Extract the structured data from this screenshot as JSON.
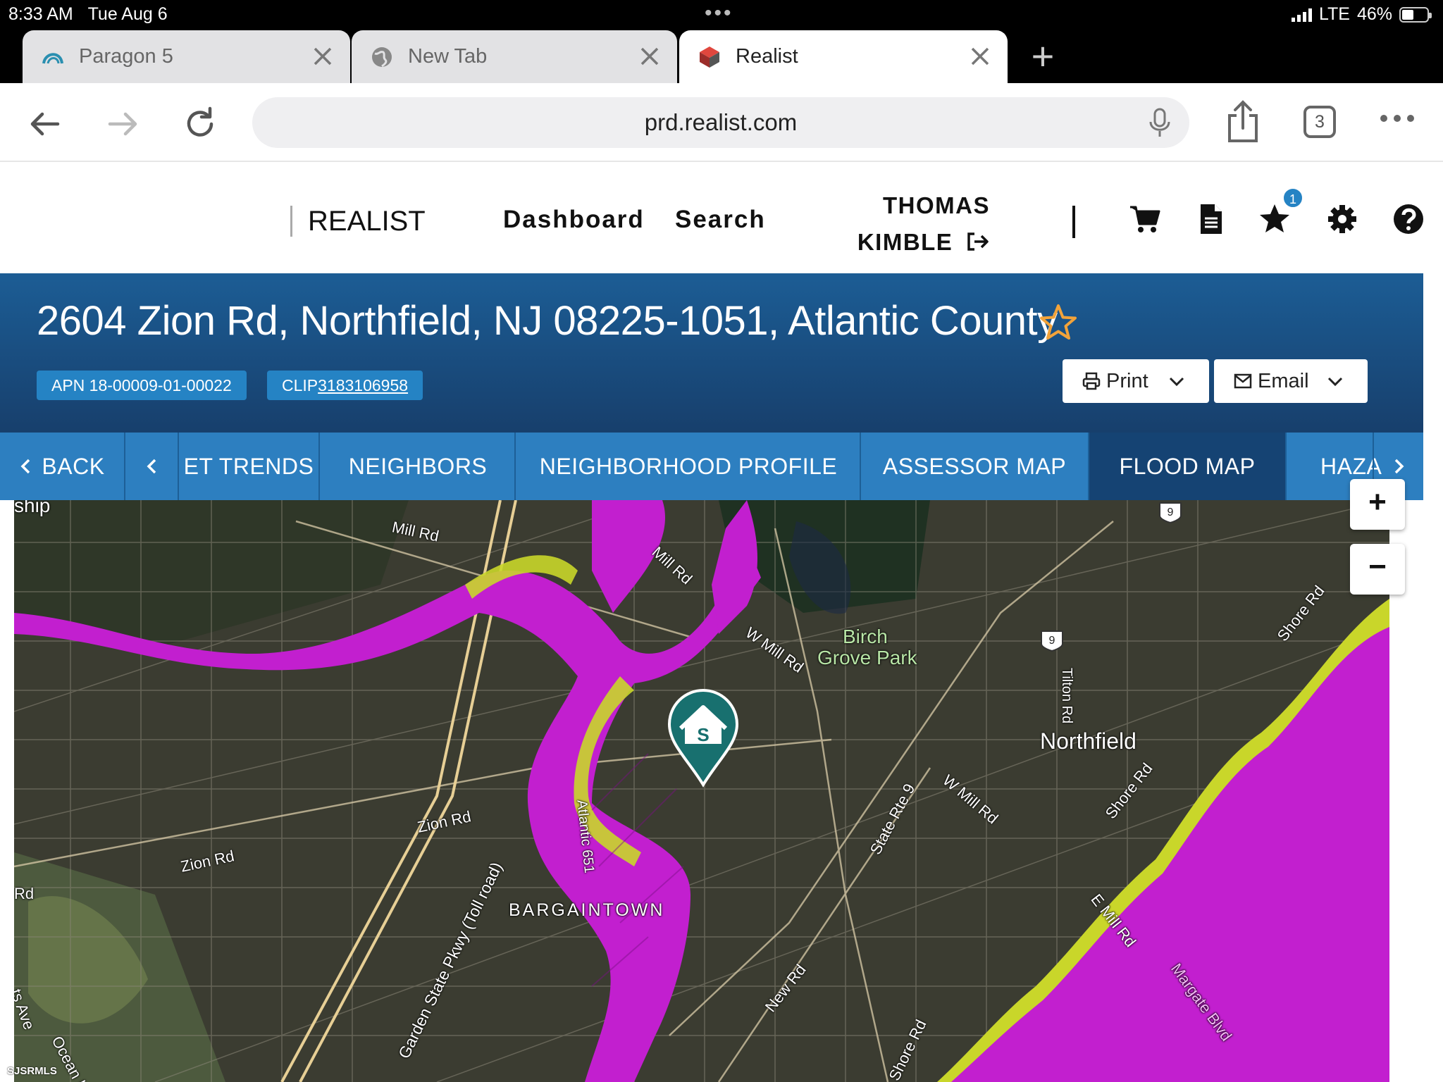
{
  "status_bar": {
    "time": "8:33 AM",
    "date": "Tue Aug 6",
    "network": "LTE",
    "battery": "46%"
  },
  "browser": {
    "tabs": [
      {
        "title": "Paragon 5",
        "icon": "paragon-icon"
      },
      {
        "title": "New Tab",
        "icon": "globe-icon"
      },
      {
        "title": "Realist",
        "icon": "realist-icon",
        "active": true
      }
    ],
    "url": "prd.realist.com",
    "tab_count": "3"
  },
  "site": {
    "logo": "REALIST",
    "nav": {
      "dashboard": "Dashboard",
      "search": "Search"
    },
    "user": {
      "first": "THOMAS",
      "last": "KIMBLE"
    },
    "favorites_count": "1"
  },
  "property": {
    "address": "2604 Zion Rd, Northfield, NJ 08225-1051, Atlantic County",
    "apn": "APN 18-00009-01-00022",
    "clip_prefix": "CLIP",
    "clip_number": "3183106958",
    "print_label": "Print",
    "email_label": "Email"
  },
  "page_tabs": {
    "back": "BACK",
    "items": [
      "ET TRENDS",
      "NEIGHBORS",
      "NEIGHBORHOOD PROFILE",
      "ASSESSOR MAP",
      "FLOOD MAP",
      "HAZA"
    ],
    "active": "FLOOD MAP"
  },
  "map": {
    "labels": {
      "ship": "ship",
      "mill_rd_1": "Mill Rd",
      "mill_rd_2": "Mill Rd",
      "w_mill_rd_1": "W Mill Rd",
      "w_mill_rd_2": "W Mill Rd",
      "birch": "Birch",
      "grove_park": "Grove Park",
      "northfield": "Northfield",
      "tilton_rd": "Tilton Rd",
      "shore_rd_1": "Shore Rd",
      "shore_rd_2": "Shore Rd",
      "shore_rd_3": "Shore Rd",
      "zion_rd_1": "Zion Rd",
      "zion_rd_2": "Zion Rd",
      "rd": "Rd",
      "atlantic_651": "Atlantic 651",
      "state_rte_9": "State Rte 9",
      "bargaintown": "BARGAINTOWN",
      "gsp": "Garden State Pkwy (Toll road)",
      "e_mill_rd": "E Mill Rd",
      "new_rd": "New Rd",
      "margate_blvd": "Margate Blvd",
      "ocean_h": "Ocean H",
      "ts_ave": "ts Ave",
      "route_9": "9",
      "credit": "SJSRMLS"
    },
    "zoom_in": "+",
    "zoom_out": "−",
    "colors": {
      "flood_zone": "#c21fcf",
      "flood_edge": "#c9d62a",
      "marker": "#18706f"
    }
  }
}
